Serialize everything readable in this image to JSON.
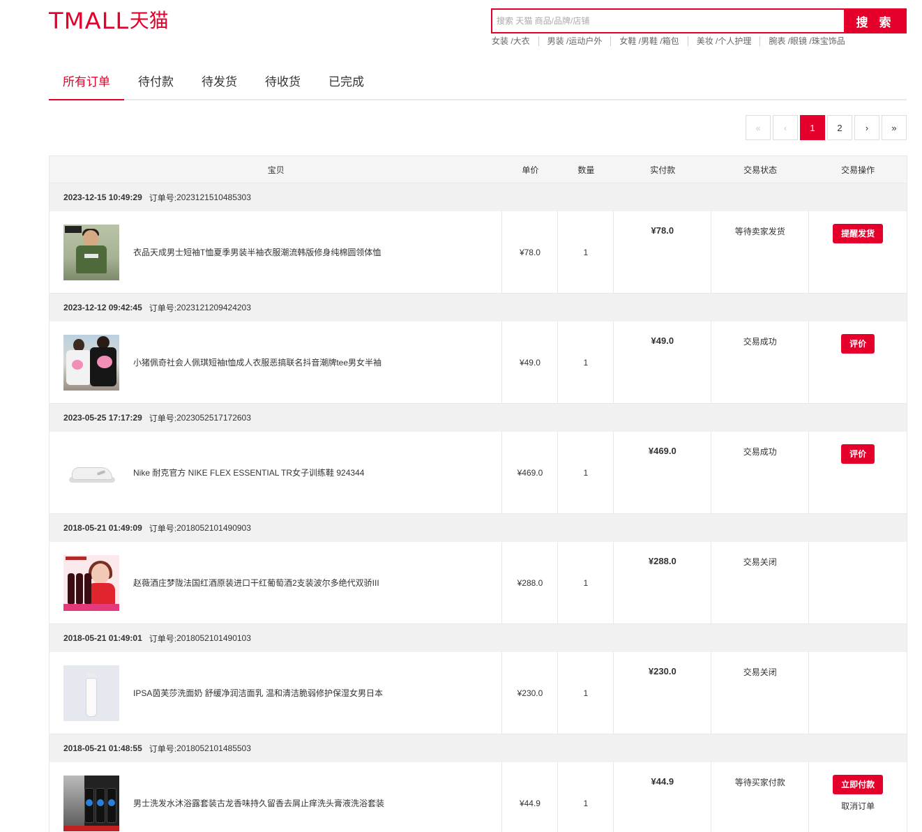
{
  "header": {
    "logo_latin": "TMALL",
    "logo_cn": "天猫",
    "search_placeholder": "搜索 天猫 商品/品牌/店铺",
    "search_button": "搜 索",
    "hot_links": [
      "女装 /大衣",
      "男装 /运动户外",
      "女鞋 /男鞋 /箱包",
      "美妆 /个人护理",
      "腕表 /眼镜 /珠宝饰品"
    ]
  },
  "tabs": [
    "所有订单",
    "待付款",
    "待发货",
    "待收货",
    "已完成"
  ],
  "active_tab": "所有订单",
  "pagination": {
    "first": "«",
    "prev": "‹",
    "pages": [
      "1",
      "2"
    ],
    "current": "1",
    "next": "›",
    "last": "»"
  },
  "columns": {
    "item": "宝贝",
    "price": "单价",
    "qty": "数量",
    "paid": "实付款",
    "status": "交易状态",
    "op": "交易操作"
  },
  "order_no_label": "订单号:",
  "orders": [
    {
      "date": "2023-12-15 10:49:29",
      "order_no": "2023121510485303",
      "title": "衣品天成男士短袖T恤夏季男装半袖衣服潮流韩版修身纯棉圆领体恤",
      "price": "¥78.0",
      "qty": "1",
      "paid": "¥78.0",
      "status": "等待卖家发货",
      "action": "提醒发货",
      "secondary_action": "",
      "thumb_icon": "tshirt-model-image"
    },
    {
      "date": "2023-12-12 09:42:45",
      "order_no": "2023121209424203",
      "title": "小猪佩奇社会人佩琪短袖t恤成人衣服恶搞联名抖音潮牌tee男女半袖",
      "price": "¥49.0",
      "qty": "1",
      "paid": "¥49.0",
      "status": "交易成功",
      "action": "评价",
      "secondary_action": "",
      "thumb_icon": "couple-tee-image"
    },
    {
      "date": "2023-05-25 17:17:29",
      "order_no": "2023052517172603",
      "title": "Nike 耐克官方 NIKE FLEX ESSENTIAL TR女子训练鞋 924344",
      "price": "¥469.0",
      "qty": "1",
      "paid": "¥469.0",
      "status": "交易成功",
      "action": "评价",
      "secondary_action": "",
      "thumb_icon": "sneaker-image"
    },
    {
      "date": "2018-05-21 01:49:09",
      "order_no": "2018052101490903",
      "title": "赵薇酒庄梦陇法国红酒原装进口干红葡萄酒2支装波尔多绝代双骄III",
      "price": "¥288.0",
      "qty": "1",
      "paid": "¥288.0",
      "status": "交易关闭",
      "action": "",
      "secondary_action": "",
      "thumb_icon": "wine-bottles-image"
    },
    {
      "date": "2018-05-21 01:49:01",
      "order_no": "2018052101490103",
      "title": "IPSA茵芙莎洗面奶 舒缓净润洁面乳 温和清洁脆弱修护保湿女男日本",
      "price": "¥230.0",
      "qty": "1",
      "paid": "¥230.0",
      "status": "交易关闭",
      "action": "",
      "secondary_action": "",
      "thumb_icon": "cleanser-tube-image"
    },
    {
      "date": "2018-05-21 01:48:55",
      "order_no": "2018052101485503",
      "title": "男士洗发水沐浴露套装古龙香味持久留香去屑止痒洗头膏液洗浴套装",
      "price": "¥44.9",
      "qty": "1",
      "paid": "¥44.9",
      "status": "等待买家付款",
      "action": "立即付款",
      "secondary_action": "取消订单",
      "thumb_icon": "shampoo-set-image"
    }
  ],
  "colors": {
    "brand": "#e4002b",
    "header_bg": "#f5f5f5",
    "order_head_bg": "#f1f1f1"
  }
}
